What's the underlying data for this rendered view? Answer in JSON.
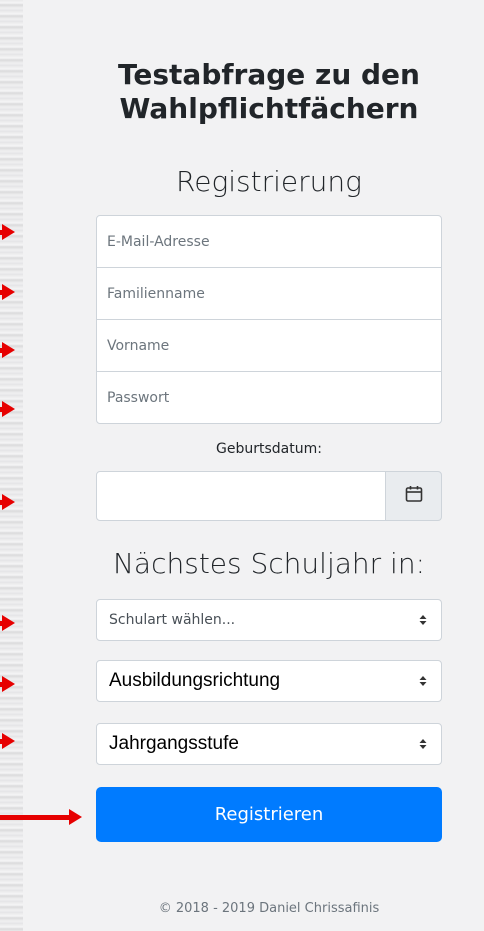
{
  "title": "Testabfrage zu den Wahlpflichtfächern",
  "registration_heading": "Registrierung",
  "fields": {
    "email_placeholder": "E-Mail-Adresse",
    "last_name_placeholder": "Familienname",
    "first_name_placeholder": "Vorname",
    "password_placeholder": "Passwort"
  },
  "birthdate_label": "Geburtsdatum:",
  "next_year_heading": "Nächstes Schuljahr in:",
  "selects": {
    "school_type": "Schulart wählen...",
    "direction": "Ausbildungsrichtung",
    "grade": "Jahrgangsstufe"
  },
  "submit_label": "Registrieren",
  "footer": "© 2018 - 2019 Daniel Chrissafinis",
  "colors": {
    "primary": "#007bff",
    "arrow": "#e60000",
    "panel": "#f2f2f3"
  },
  "icons": {
    "date_picker": "calendar-icon",
    "select_caret": "sort-caret-icon",
    "annotation": "arrow-right-icon"
  }
}
